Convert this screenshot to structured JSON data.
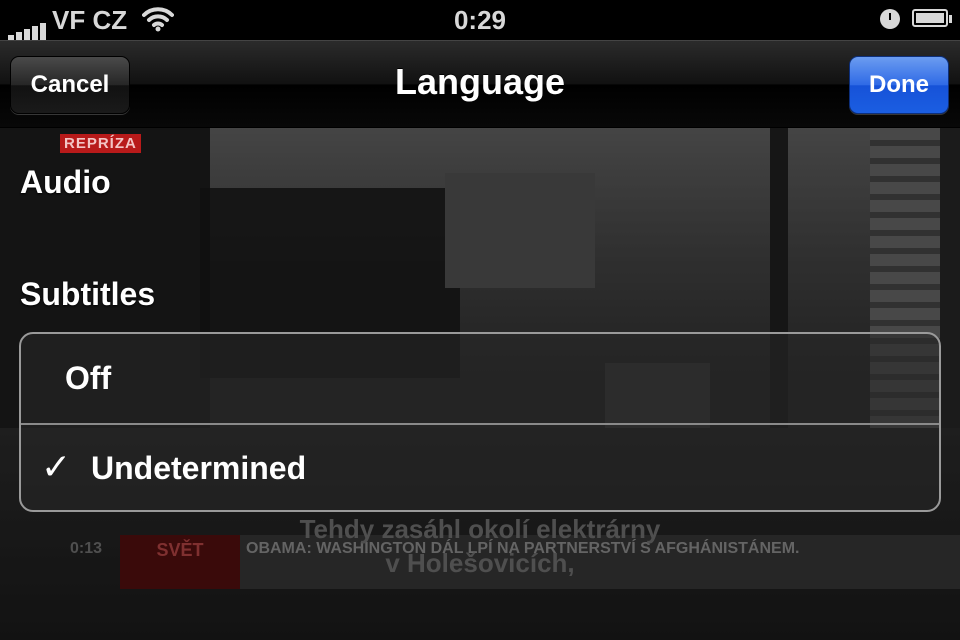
{
  "status_bar": {
    "carrier": "VF CZ",
    "time": "0:29"
  },
  "nav": {
    "title": "Language",
    "cancel_label": "Cancel",
    "done_label": "Done"
  },
  "video": {
    "badge": "REPRÍZA",
    "subtitle_line1": "Tehdy zasáhl okolí elektrárny",
    "subtitle_line2": "v Holešovicích,",
    "ticker_time": "0:13",
    "ticker_tag": "SVĚT",
    "ticker_text": "OBAMA: WASHINGTON DÁL LPÍ NA PARTNERSTVÍ S AFGHÁNISTÁNEM."
  },
  "sections": {
    "audio_header": "Audio",
    "subtitles_header": "Subtitles"
  },
  "subtitle_options": [
    {
      "label": "Off",
      "selected": false
    },
    {
      "label": "Undetermined",
      "selected": true
    }
  ],
  "icons": {
    "check": "✓"
  },
  "colors": {
    "done_button": "#1b5ee2",
    "badge_red": "#b81a1a"
  }
}
